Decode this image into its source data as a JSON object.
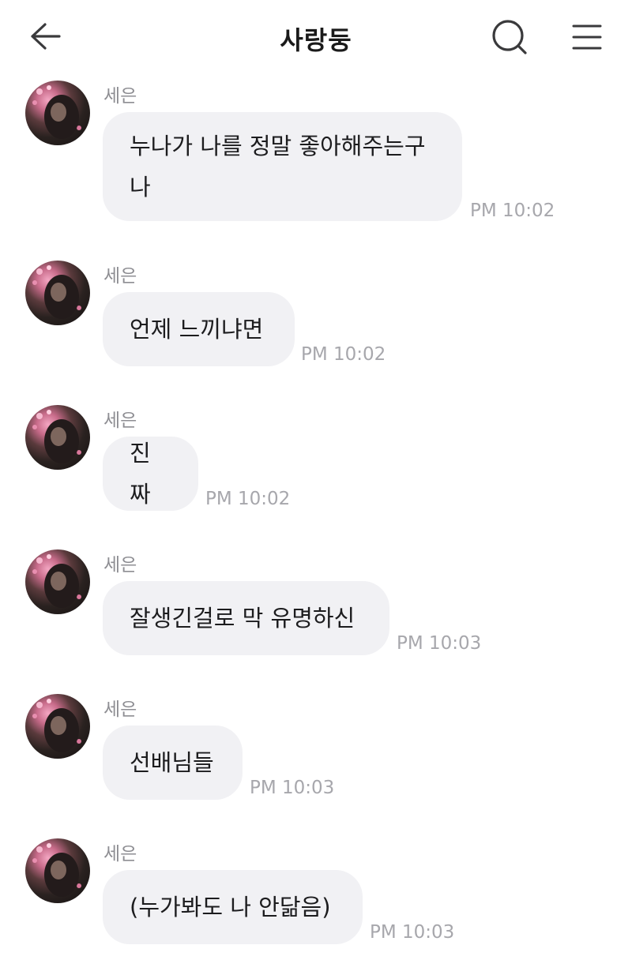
{
  "header": {
    "title": "사랑둥"
  },
  "icons": {
    "back": "back-arrow-icon",
    "search": "search-icon",
    "menu": "hamburger-menu-icon"
  },
  "messages": [
    {
      "sender": "세은",
      "text": "누나가 나를 정말 좋아해주는구\n나",
      "time": "PM 10:02"
    },
    {
      "sender": "세은",
      "text": "언제 느끼냐면",
      "time": "PM 10:02"
    },
    {
      "sender": "세은",
      "text": "진짜",
      "time": "PM 10:02"
    },
    {
      "sender": "세은",
      "text": "잘생긴걸로 막 유명하신",
      "time": "PM 10:03"
    },
    {
      "sender": "세은",
      "text": "선배님들",
      "time": "PM 10:03"
    },
    {
      "sender": "세은",
      "text": "(누가봐도 나 안닮음)",
      "time": "PM 10:03"
    }
  ],
  "colors": {
    "bubble": "#f1f1f4",
    "sender": "#8e8e93",
    "time": "#a7a7ac",
    "text": "#1c1c1e"
  }
}
